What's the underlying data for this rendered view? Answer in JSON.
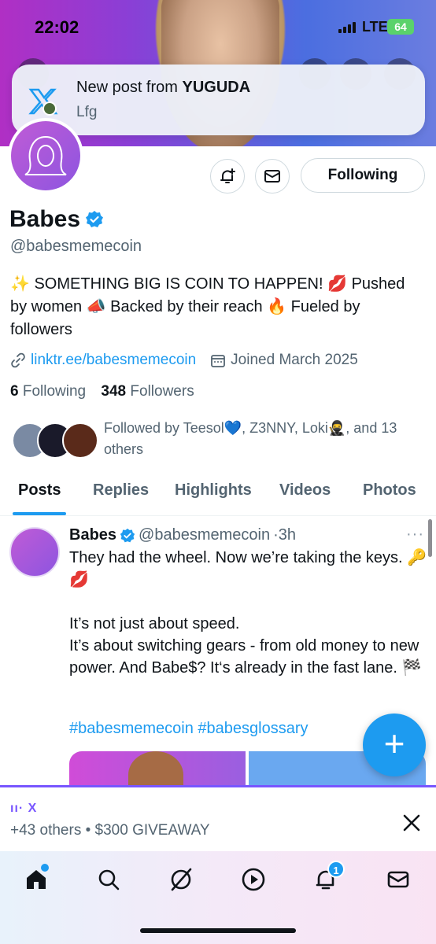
{
  "status_bar": {
    "time": "22:02",
    "network": "LTE",
    "battery": "64"
  },
  "notification": {
    "title_prefix": "New post from ",
    "title_user": "YUGUDA",
    "body": "Lfg"
  },
  "profile": {
    "name": "Babes",
    "handle": "@babesmemecoin",
    "bio": "✨ SOMETHING BIG IS COIN TO HAPPEN! 💋 Pushed by women 📣 Backed by their reach 🔥 Fueled by followers",
    "link": "linktr.ee/babesmemecoin",
    "joined": "Joined March 2025",
    "following_count": "6",
    "following_label": "Following",
    "followers_count": "348",
    "followers_label": "Followers",
    "followed_by": "Followed by Teesol💙, Z3NNY, Loki🥷, and 13 others",
    "follow_button": "Following"
  },
  "tabs": [
    "Posts",
    "Replies",
    "Highlights",
    "Videos",
    "Photos"
  ],
  "post": {
    "name": "Babes",
    "handle": "@babesmemecoin",
    "time": "·3h",
    "more": "···",
    "text": "They had the wheel. Now we’re taking the keys. 🔑 💋\n\nIt’s not just about speed.\nIt’s about switching gears - from old money to new power. And Babe$? It‘s already in the fast lane. 🏁",
    "hashtags": "#babesmemecoin #babesglossary"
  },
  "fab": {
    "label": "+"
  },
  "spaces": {
    "brand": "X",
    "text": "+43 others • $300 GIVEAWAY"
  },
  "bottom_nav": {
    "items": [
      "home-icon",
      "search-icon",
      "grok-icon",
      "video-icon",
      "notifications-icon",
      "messages-icon"
    ],
    "notifications_badge": "1"
  },
  "colors": {
    "accent": "#1d9bf0",
    "spaces": "#7856ff",
    "text": "#0f1419",
    "muted": "#536471"
  }
}
